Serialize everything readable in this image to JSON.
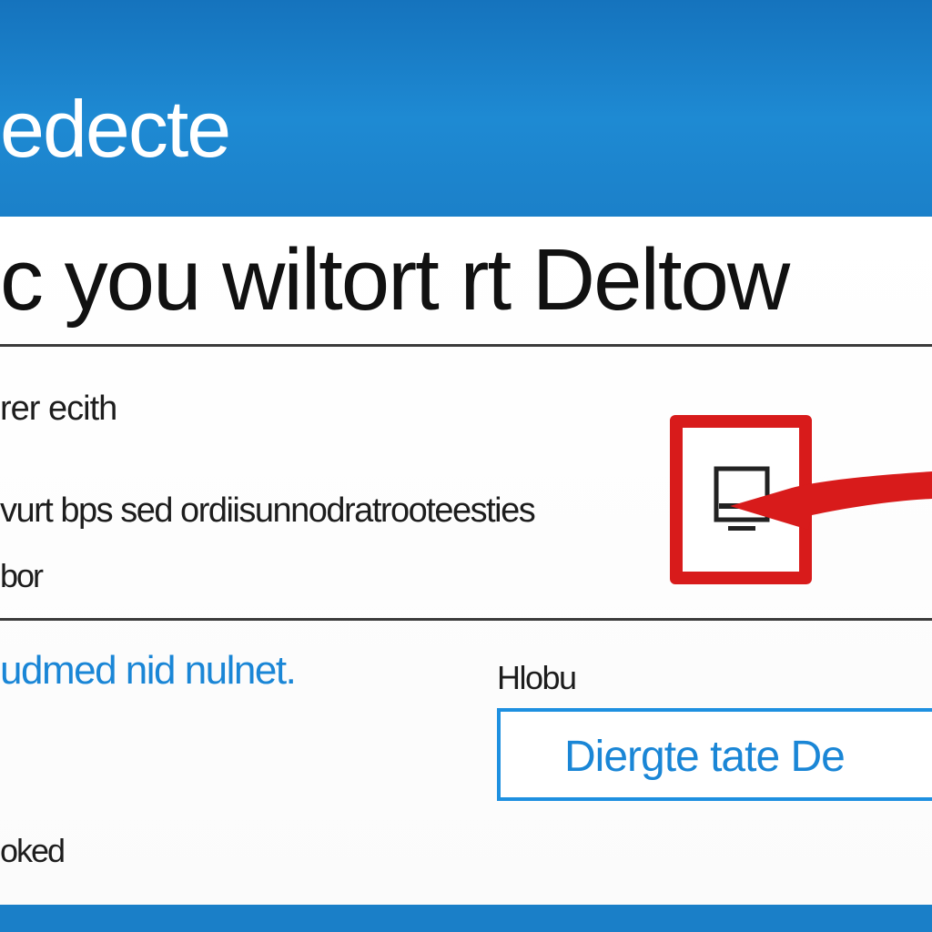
{
  "header": {
    "title": "edecte"
  },
  "dialog": {
    "title": "c you wiltort rt Deltow",
    "section_label": "rer ecith",
    "description": "vurt bps sed ordiisunnodratrooteesties",
    "small_note": "bor",
    "link_text": "udmed nid nulnet.",
    "field_label": "Hlobu",
    "action_button_label": "Diergte tate De",
    "footer_text": "oked"
  },
  "icons": {
    "highlight": "device-remove-icon",
    "arrow": "red-arrow-pointer"
  },
  "colors": {
    "header_blue": "#1b80c9",
    "highlight_red": "#d81b1b",
    "link_blue": "#1a86d6",
    "button_border": "#1e90e0"
  }
}
